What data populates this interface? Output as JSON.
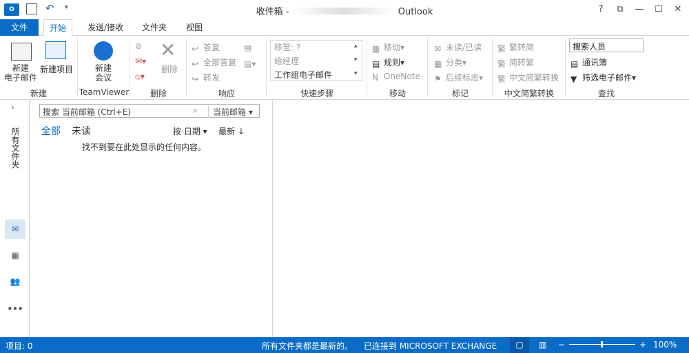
{
  "window": {
    "title_prefix": "收件箱 -",
    "title_app": "Outlook",
    "controls": [
      "?",
      "⧉",
      "—",
      "☐",
      "✕"
    ]
  },
  "tabs": [
    {
      "label": "文件"
    },
    {
      "label": "开始"
    },
    {
      "label": "发送/接收"
    },
    {
      "label": "文件夹"
    },
    {
      "label": "视图"
    }
  ],
  "ribbon": {
    "new_email": "新建\n电子邮件",
    "new_item": "新建项目",
    "group_new": "新建",
    "new_meeting": "新建\n会议",
    "group_teamviewer": "TeamViewer",
    "delete": "删除",
    "group_delete": "删除",
    "reply": "答复",
    "reply_all": "全部答复",
    "forward": "转发",
    "group_respond": "响应",
    "quick_steps": [
      "移至: ?",
      "给经理",
      "工作组电子邮件"
    ],
    "group_quick": "快速步骤",
    "move": "移动",
    "rules": "规则",
    "onenote": "OneNote",
    "group_move": "移动",
    "unread": "未读/已读",
    "categorize": "分类",
    "followup": "后续标志",
    "group_tags": "标记",
    "t2s": "繁转简",
    "s2t": "简转繁",
    "convert": "中文简繁转换",
    "group_convert": "中文简繁转换",
    "search_people": "搜索人员",
    "address_book": "通讯簿",
    "filter_email": "筛选电子邮件",
    "group_find": "查找"
  },
  "folder_pane": {
    "label": "所有文件夹"
  },
  "list": {
    "search_placeholder": "搜索 当前邮箱 (Ctrl+E)",
    "scope": "当前邮箱",
    "filter_all": "全部",
    "filter_unread": "未读",
    "sort_by": "按 日期",
    "sort_order": "最新 ↓",
    "empty": "找不到要在此处显示的任何内容。"
  },
  "status": {
    "items": "项目: 0",
    "uptodate": "所有文件夹都是最新的。",
    "connected": "已连接到 MICROSOFT EXCHANGE",
    "zoom": "100%"
  },
  "colors": {
    "accent": "#0a6cc6"
  }
}
